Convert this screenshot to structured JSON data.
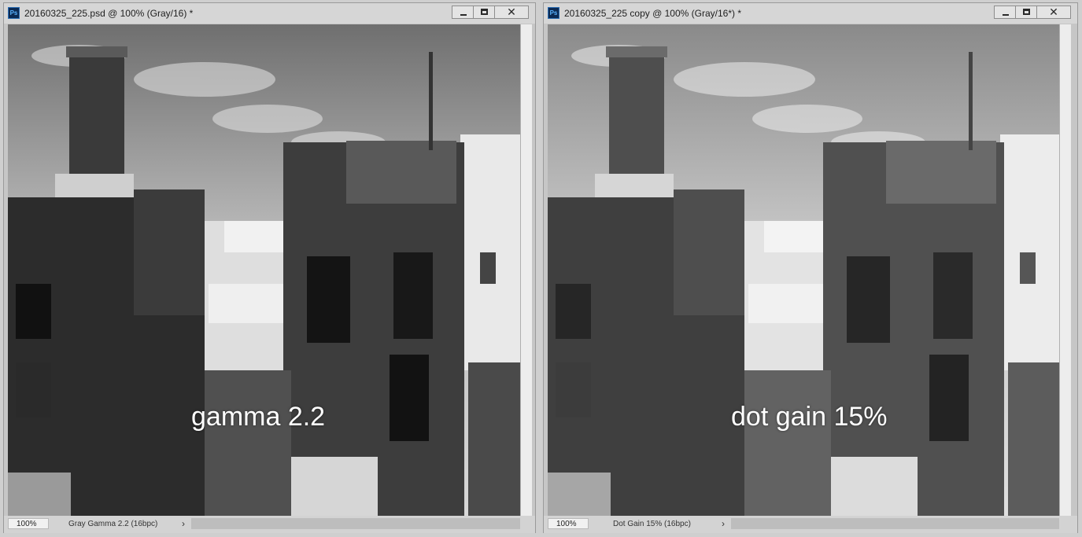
{
  "windows": [
    {
      "title": "20160325_225.psd @ 100% (Gray/16) *",
      "app_icon": "Ps",
      "overlay_label": "gamma 2.2",
      "status": {
        "zoom": "100%",
        "profile": "Gray Gamma 2.2 (16bpc)"
      },
      "tone": "gamma"
    },
    {
      "title": "20160325_225 copy @ 100% (Gray/16*) *",
      "app_icon": "Ps",
      "overlay_label": "dot gain 15%",
      "status": {
        "zoom": "100%",
        "profile": "Dot Gain 15% (16bpc)"
      },
      "tone": "dotgain"
    }
  ],
  "window_controls": {
    "minimize": "minimize-icon",
    "maximize": "maximize-icon",
    "close": "close-icon"
  },
  "colors": {
    "titlebar": "#d6d6d6",
    "frame": "#c6c6c6",
    "overlay_text": "#ffffff"
  }
}
